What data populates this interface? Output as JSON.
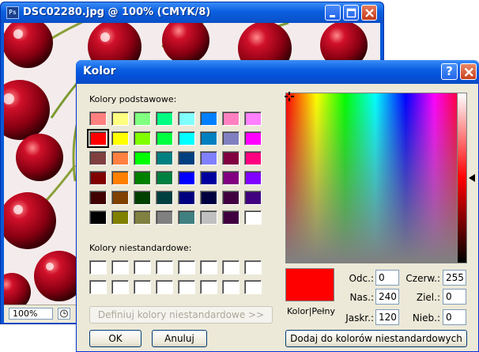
{
  "document_window": {
    "title": "DSC02280.jpg @ 100% (CMYK/8)",
    "zoom": "100%"
  },
  "dialog": {
    "title": "Kolor",
    "basic_colors_label": "Kolory podstawowe:",
    "basic_colors": [
      "#ff8080",
      "#ffff80",
      "#80ff80",
      "#00ff80",
      "#80ffff",
      "#0080ff",
      "#ff80c0",
      "#ff80ff",
      "#ff0000",
      "#ffff00",
      "#80ff00",
      "#00ff40",
      "#00ffff",
      "#0080c0",
      "#8080c0",
      "#ff00ff",
      "#804040",
      "#ff8040",
      "#00ff00",
      "#008080",
      "#004080",
      "#8080ff",
      "#800040",
      "#ff0080",
      "#800000",
      "#ff8000",
      "#008000",
      "#008040",
      "#0000ff",
      "#0000a0",
      "#800080",
      "#8000ff",
      "#400000",
      "#804000",
      "#004000",
      "#004040",
      "#000080",
      "#000040",
      "#400040",
      "#400080",
      "#000000",
      "#808000",
      "#808040",
      "#808080",
      "#408080",
      "#c0c0c0",
      "#400040",
      "#ffffff"
    ],
    "selected_basic_index": 8,
    "custom_colors_label": "Kolory niestandardowe:",
    "define_custom_button": "Definiuj kolory niestandardowe >>",
    "ok_button": "OK",
    "cancel_button": "Anuluj",
    "preview_label": "Kolor|Pełny",
    "preview_color": "#ff0000",
    "fields": {
      "hue_label": "Odc.:",
      "hue_value": "0",
      "sat_label": "Nas.:",
      "sat_value": "240",
      "lum_label": "Jaskr.:",
      "lum_value": "120",
      "red_label": "Czerw.:",
      "red_value": "255",
      "green_label": "Ziel.:",
      "green_value": "0",
      "blue_label": "Nieb.:",
      "blue_value": "0"
    },
    "add_custom_button": "Dodaj do kolorów niestandardowych"
  }
}
